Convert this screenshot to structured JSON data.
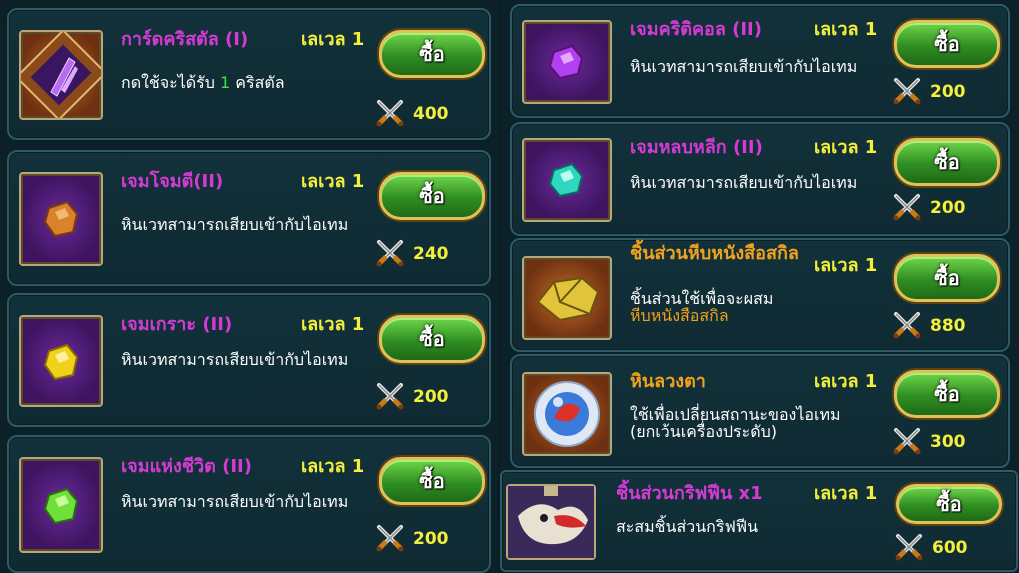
{
  "buy_label": "ซื้อ",
  "left_items": [
    {
      "title": "การ์ดคริสตัล (I)",
      "level": "เลเวล 1",
      "desc_pre": "กดใช้จะได้รับ ",
      "desc_num": "1",
      "desc_post": " คริสตัล",
      "price": "400",
      "icon": "crystal-card-icon"
    },
    {
      "title": "เจมโจมตี(II)",
      "level": "เลเวล 1",
      "desc": "หินเวทสามารถเสียบเข้ากับไอเทม",
      "price": "240",
      "gem_color": "#d9822b",
      "icon": "orange-gem-icon"
    },
    {
      "title": "เจมเกราะ (II)",
      "level": "เลเวล 1",
      "desc": "หินเวทสามารถเสียบเข้ากับไอเทม",
      "price": "200",
      "gem_color": "#f0d21a",
      "icon": "yellow-gem-icon"
    },
    {
      "title": "เจมแห่งชีวิต (II)",
      "level": "เลเวล 1",
      "desc": "หินเวทสามารถเสียบเข้ากับไอเทม",
      "price": "200",
      "gem_color": "#6fe03a",
      "icon": "green-gem-icon"
    }
  ],
  "right_items": [
    {
      "title": "เจมคริติคอล (II)",
      "level": "เลเวล 1",
      "desc": "หินเวทสามารถเสียบเข้ากับไอเทม",
      "price": "200",
      "gem_color": "#b040f0",
      "icon": "purple-gem-icon"
    },
    {
      "title": "เจมหลบหลีก (II)",
      "level": "เลเวล 1",
      "desc": "หินเวทสามารถเสียบเข้ากับไอเทม",
      "price": "200",
      "gem_color": "#2fd6c0",
      "icon": "teal-gem-icon"
    },
    {
      "title": "ชิ้นส่วนหีบหนังสือสกิล",
      "level": "เลเวล 1",
      "desc": "ชิ้นส่วนใช้เพื่อจะผสม",
      "desc_orange": "หีบหนังสือสกิล",
      "price": "880",
      "icon": "skill-chest-fragment-icon"
    },
    {
      "title": "หินลวงตา",
      "level": "เลเวล 1",
      "desc": "ใช้เพื่อเปลี่ยนสถานะของไอเทม (ยกเว้นเครื่องประดับ)",
      "price": "300",
      "icon": "illusion-stone-icon"
    },
    {
      "title": "ชิ้นส่วนกริฟฟีน x1",
      "level": "เลเวล 1",
      "desc": "สะสมชิ้นส่วนกริฟฟีน",
      "price": "600",
      "icon": "griffin-fragment-icon"
    }
  ]
}
